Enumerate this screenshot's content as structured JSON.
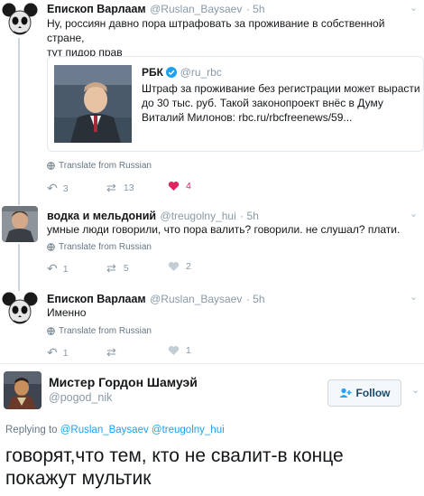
{
  "tweet1": {
    "name": "Епископ Варлаам",
    "handle": "@Ruslan_Baysaev",
    "time": "· 5h",
    "text_line1": "Ну, россиян давно пора штрафовать за проживание в собственной стране,",
    "text_line2": "тут пидор прав",
    "card": {
      "source": "РБК",
      "handle": "@ru_rbc",
      "line1": "Штраф за проживание без регистрации может вырасти",
      "line2": "до 30 тыс. руб. Такой законопроект внёс в Думу",
      "line3": "Виталий Милонов: rbc.ru/rbcfreenews/59..."
    },
    "translate": "Translate from Russian",
    "replies": "3",
    "retweets": "13",
    "likes": "4"
  },
  "tweet2": {
    "name": "водка и мельдоний",
    "handle": "@treugolny_hui",
    "time": "· 5h",
    "text": "умные люди говорили, что пора валить? говорили. не слушал? плати.",
    "translate": "Translate from Russian",
    "replies": "1",
    "retweets": "5",
    "likes": "2"
  },
  "tweet3": {
    "name": "Епископ Варлаам",
    "handle": "@Ruslan_Baysaev",
    "time": "· 5h",
    "text": "Именно",
    "translate": "Translate from Russian",
    "replies": "1",
    "likes": "1"
  },
  "main_tweet": {
    "name": "Мистер Гордон Шамуэй",
    "handle": "@pogod_nik",
    "follow_label": "Follow",
    "replying_prefix": "Replying to",
    "replying_to": "@Ruslan_Baysaev @treugolny_hui",
    "text_line1": "говорят,что тем, кто не свалит-в конце",
    "text_line2": "покажут мультик"
  },
  "colors": {
    "like_active": "#e0245e",
    "link": "#1da1f2",
    "muted": "#8899a6",
    "verified": "#1da1f2"
  }
}
